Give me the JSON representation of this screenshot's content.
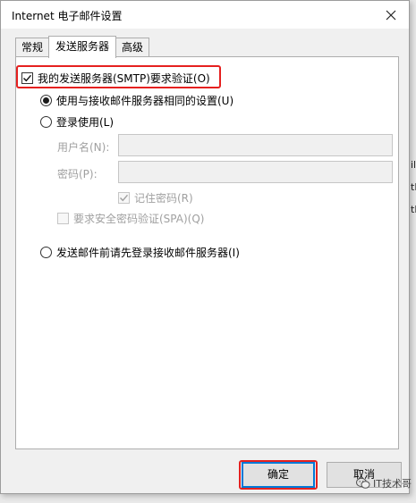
{
  "background": {
    "fragments": [
      "ilo",
      "tlo",
      "tlo"
    ]
  },
  "dialog": {
    "title": "Internet 电子邮件设置",
    "close_icon": "close-icon"
  },
  "tabs": [
    {
      "label": "常规",
      "active": false
    },
    {
      "label": "发送服务器",
      "active": true
    },
    {
      "label": "高级",
      "active": false
    }
  ],
  "panel": {
    "smtp_auth": {
      "label": "我的发送服务器(SMTP)要求验证(O)",
      "checked": true
    },
    "same_as_incoming": {
      "label": "使用与接收邮件服务器相同的设置(U)",
      "selected": true
    },
    "login_using": {
      "label": "登录使用(L)",
      "selected": false
    },
    "username": {
      "label": "用户名(N):",
      "value": ""
    },
    "password": {
      "label": "密码(P):",
      "value": ""
    },
    "remember_password": {
      "label": "记住密码(R)",
      "checked": true
    },
    "require_spa": {
      "label": "要求安全密码验证(SPA)(Q)",
      "checked": false
    },
    "login_incoming_first": {
      "label": "发送邮件前请先登录接收邮件服务器(I)",
      "selected": false
    }
  },
  "buttons": {
    "ok": "确定",
    "cancel": "取消"
  },
  "watermark": {
    "text": "IT技术哥",
    "icon": "wechat-icon"
  },
  "colors": {
    "highlight": "#e5201f",
    "accent": "#0078d7"
  }
}
